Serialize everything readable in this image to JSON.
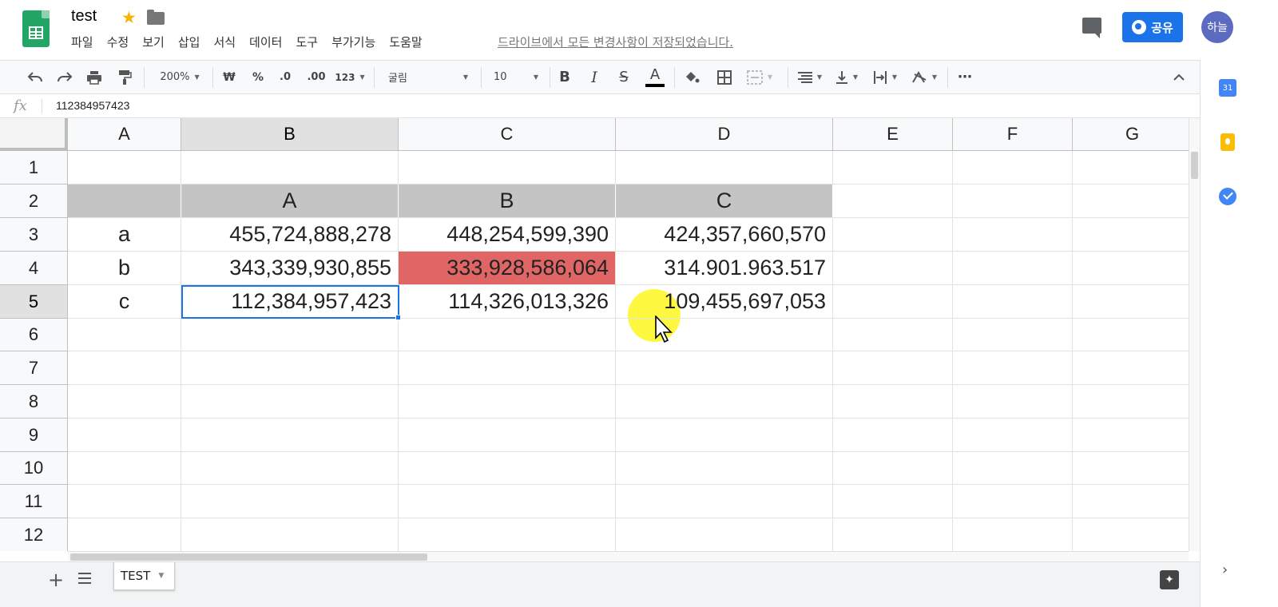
{
  "title_bar": {
    "doc_title": "test",
    "menu": [
      "파일",
      "수정",
      "보기",
      "삽입",
      "서식",
      "데이터",
      "도구",
      "부가기능",
      "도움말"
    ],
    "save_status": "드라이브에서 모든 변경사항이 저장되었습니다.",
    "share_label": "공유",
    "avatar_initials": "하늘"
  },
  "toolbar": {
    "zoom": "200%",
    "currency": "₩",
    "percent": "%",
    "decrease_decimal": ".0",
    "increase_decimal": ".00",
    "more_formats": "123",
    "font_name": "굴림",
    "font_size": "10",
    "bold": "B",
    "italic": "I",
    "strikethrough": "S",
    "text_color": "A",
    "more": "⋯"
  },
  "formula_bar": {
    "fx": "fx",
    "value": "112384957423"
  },
  "grid": {
    "columns": [
      "A",
      "B",
      "C",
      "D",
      "E",
      "F",
      "G"
    ],
    "rows": [
      "1",
      "2",
      "3",
      "4",
      "5",
      "6",
      "7",
      "8",
      "9",
      "10",
      "11",
      "12"
    ],
    "selected_column": "B",
    "selected_row": "5",
    "header_row": [
      "A",
      "B",
      "C"
    ],
    "labels": [
      "a",
      "b",
      "c"
    ],
    "values": [
      [
        "455,724,888,278",
        "448,254,599,390",
        "424,357,660,570"
      ],
      [
        "343,339,930,855",
        "333,928,586,064",
        "314.901.963.517"
      ],
      [
        "112,384,957,423",
        "114,326,013,326",
        "109,455,697,053"
      ]
    ]
  },
  "colors": {
    "accent": "#1a73e8",
    "header_gray": "#c4c4c4",
    "highlight_red": "#e06666",
    "sheets_green": "#23a566"
  },
  "bottom_bar": {
    "sheet_tab": "TEST"
  },
  "side_panel": {
    "calendar_day": "31"
  }
}
